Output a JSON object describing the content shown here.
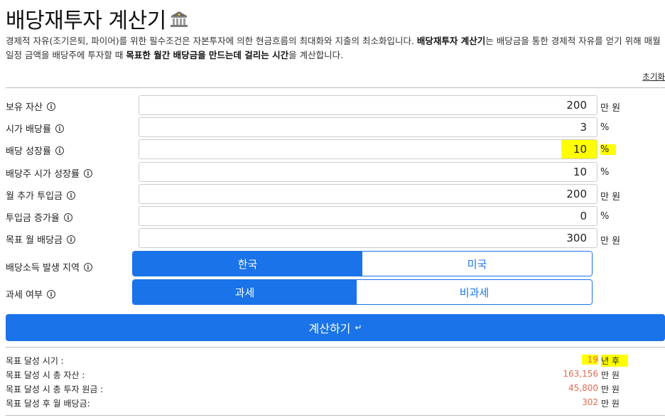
{
  "header": {
    "title": "배당재투자 계산기",
    "title_icon": "bank-building-icon",
    "desc_part1": "경제적 자유(조기은퇴, 파이어)를 위한 필수조건은 자본투자에 의한 현금흐름의 최대화와 지출의 최소화입니다. ",
    "desc_bold1": "배당재투자 계산기",
    "desc_part2": "는 배당금을 통한 경제적 자유를 얻기 위해 매월 일정 금액을 배당주에 투자할 때 ",
    "desc_bold2": "목표한 월간 배당금을 만드는데 걸리는 시간",
    "desc_part3": "을 계산합니다.",
    "reset_label": "초기화"
  },
  "form": {
    "fields": [
      {
        "label": "보유 자산",
        "value": "200",
        "unit": "만 원"
      },
      {
        "label": "시가 배당률",
        "value": "3",
        "unit": "%"
      },
      {
        "label": "배당 성장률",
        "value": "10",
        "unit": "%"
      },
      {
        "label": "배당주 시가 성장률",
        "value": "10",
        "unit": "%"
      },
      {
        "label": "월 추가 투입금",
        "value": "200",
        "unit": "만 원"
      },
      {
        "label": "투입금 증가율",
        "value": "0",
        "unit": "%"
      },
      {
        "label": "목표 월 배당금",
        "value": "300",
        "unit": "만 원"
      }
    ],
    "region": {
      "label": "배당소득 발생 지역",
      "options": [
        "한국",
        "미국"
      ],
      "selected": "한국"
    },
    "tax": {
      "label": "과세 여부",
      "options": [
        "과세",
        "비과세"
      ],
      "selected": "과세"
    },
    "calc_label": "계산하기",
    "calc_icon": "enter-return-icon",
    "info_icon": "info-circle-icon"
  },
  "results": {
    "rows": [
      {
        "label": "목표 달성 시기 :",
        "value": "19",
        "unit": "년 후"
      },
      {
        "label": "목표 달성 시 총 자산 :",
        "value": "163,156",
        "unit": "만 원"
      },
      {
        "label": "목표 달성 시 총 투자 원금 :",
        "value": "45,800",
        "unit": "만 원"
      },
      {
        "label": "목표 달성 후 월 배당금:",
        "value": "302",
        "unit": "만 원"
      }
    ]
  },
  "colors": {
    "accent": "#1a73e8",
    "result_value": "#e26a4e",
    "highlight": "#ffff00"
  }
}
